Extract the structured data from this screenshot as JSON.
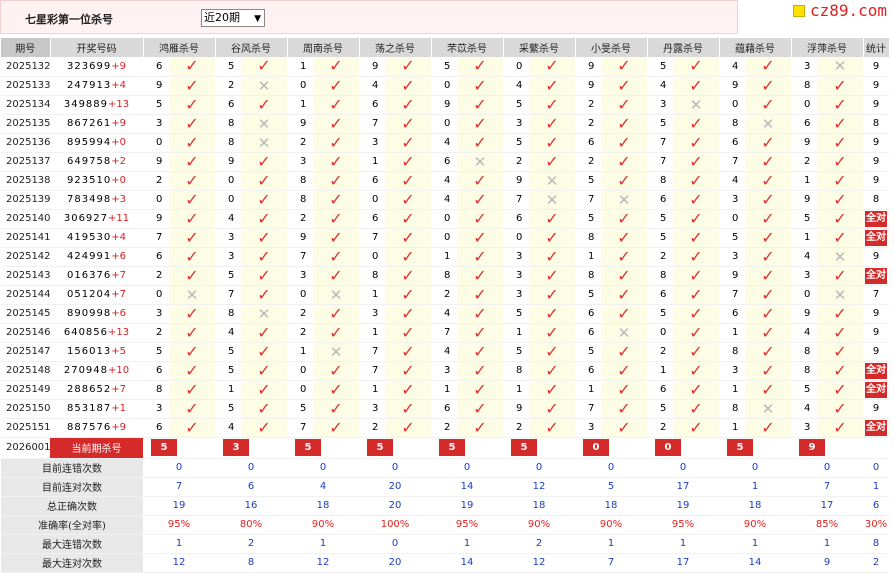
{
  "title": "七星彩第一位杀号",
  "period_select": {
    "value": "近20期"
  },
  "brand": {
    "text": "cz89.com"
  },
  "headers": [
    "期号",
    "开奖号码",
    "鸿雁杀号",
    "谷风杀号",
    "周南杀号",
    "荡之杀号",
    "芣苡杀号",
    "采蘩杀号",
    "小旻杀号",
    "丹露杀号",
    "蕴藉杀号",
    "浮萍杀号",
    "统计"
  ],
  "rows": [
    {
      "issue": "2025132",
      "draw": "323699",
      "plus": "+9",
      "kills": [
        [
          "6",
          1
        ],
        [
          "5",
          1
        ],
        [
          "1",
          1
        ],
        [
          "9",
          1
        ],
        [
          "5",
          1
        ],
        [
          "0",
          1
        ],
        [
          "9",
          1
        ],
        [
          "5",
          1
        ],
        [
          "4",
          1
        ],
        [
          "3",
          0
        ]
      ],
      "stat": "9"
    },
    {
      "issue": "2025133",
      "draw": "247913",
      "plus": "+4",
      "kills": [
        [
          "9",
          1
        ],
        [
          "2",
          0
        ],
        [
          "0",
          1
        ],
        [
          "4",
          1
        ],
        [
          "0",
          1
        ],
        [
          "4",
          1
        ],
        [
          "9",
          1
        ],
        [
          "4",
          1
        ],
        [
          "9",
          1
        ],
        [
          "8",
          1
        ]
      ],
      "stat": "9"
    },
    {
      "issue": "2025134",
      "draw": "349889",
      "plus": "+13",
      "kills": [
        [
          "5",
          1
        ],
        [
          "6",
          1
        ],
        [
          "1",
          1
        ],
        [
          "6",
          1
        ],
        [
          "9",
          1
        ],
        [
          "5",
          1
        ],
        [
          "2",
          1
        ],
        [
          "3",
          0
        ],
        [
          "0",
          1
        ],
        [
          "0",
          1
        ]
      ],
      "stat": "9"
    },
    {
      "issue": "2025135",
      "draw": "867261",
      "plus": "+9",
      "kills": [
        [
          "3",
          1
        ],
        [
          "8",
          0
        ],
        [
          "9",
          1
        ],
        [
          "7",
          1
        ],
        [
          "0",
          1
        ],
        [
          "3",
          1
        ],
        [
          "2",
          1
        ],
        [
          "5",
          1
        ],
        [
          "8",
          0
        ],
        [
          "6",
          1
        ]
      ],
      "stat": "8"
    },
    {
      "issue": "2025136",
      "draw": "895994",
      "plus": "+0",
      "kills": [
        [
          "0",
          1
        ],
        [
          "8",
          0
        ],
        [
          "2",
          1
        ],
        [
          "3",
          1
        ],
        [
          "4",
          1
        ],
        [
          "5",
          1
        ],
        [
          "6",
          1
        ],
        [
          "7",
          1
        ],
        [
          "6",
          1
        ],
        [
          "9",
          1
        ]
      ],
      "stat": "9"
    },
    {
      "issue": "2025137",
      "draw": "649758",
      "plus": "+2",
      "kills": [
        [
          "9",
          1
        ],
        [
          "9",
          1
        ],
        [
          "3",
          1
        ],
        [
          "1",
          1
        ],
        [
          "6",
          0
        ],
        [
          "2",
          1
        ],
        [
          "2",
          1
        ],
        [
          "7",
          1
        ],
        [
          "7",
          1
        ],
        [
          "2",
          1
        ]
      ],
      "stat": "9"
    },
    {
      "issue": "2025138",
      "draw": "923510",
      "plus": "+0",
      "kills": [
        [
          "2",
          1
        ],
        [
          "0",
          1
        ],
        [
          "8",
          1
        ],
        [
          "6",
          1
        ],
        [
          "4",
          1
        ],
        [
          "9",
          0
        ],
        [
          "5",
          1
        ],
        [
          "8",
          1
        ],
        [
          "4",
          1
        ],
        [
          "1",
          1
        ]
      ],
      "stat": "9"
    },
    {
      "issue": "2025139",
      "draw": "783498",
      "plus": "+3",
      "kills": [
        [
          "0",
          1
        ],
        [
          "0",
          1
        ],
        [
          "8",
          1
        ],
        [
          "0",
          1
        ],
        [
          "4",
          1
        ],
        [
          "7",
          0
        ],
        [
          "7",
          0
        ],
        [
          "6",
          1
        ],
        [
          "3",
          1
        ],
        [
          "9",
          1
        ]
      ],
      "stat": "8"
    },
    {
      "issue": "2025140",
      "draw": "306927",
      "plus": "+11",
      "kills": [
        [
          "9",
          1
        ],
        [
          "4",
          1
        ],
        [
          "2",
          1
        ],
        [
          "6",
          1
        ],
        [
          "0",
          1
        ],
        [
          "6",
          1
        ],
        [
          "5",
          1
        ],
        [
          "5",
          1
        ],
        [
          "0",
          1
        ],
        [
          "5",
          1
        ]
      ],
      "stat": "全对"
    },
    {
      "issue": "2025141",
      "draw": "419530",
      "plus": "+4",
      "kills": [
        [
          "7",
          1
        ],
        [
          "3",
          1
        ],
        [
          "9",
          1
        ],
        [
          "7",
          1
        ],
        [
          "0",
          1
        ],
        [
          "0",
          1
        ],
        [
          "8",
          1
        ],
        [
          "5",
          1
        ],
        [
          "5",
          1
        ],
        [
          "1",
          1
        ]
      ],
      "stat": "全对"
    },
    {
      "issue": "2025142",
      "draw": "424991",
      "plus": "+6",
      "kills": [
        [
          "6",
          1
        ],
        [
          "3",
          1
        ],
        [
          "7",
          1
        ],
        [
          "0",
          1
        ],
        [
          "1",
          1
        ],
        [
          "3",
          1
        ],
        [
          "1",
          1
        ],
        [
          "2",
          1
        ],
        [
          "3",
          1
        ],
        [
          "4",
          0
        ]
      ],
      "stat": "9"
    },
    {
      "issue": "2025143",
      "draw": "016376",
      "plus": "+7",
      "kills": [
        [
          "2",
          1
        ],
        [
          "5",
          1
        ],
        [
          "3",
          1
        ],
        [
          "8",
          1
        ],
        [
          "8",
          1
        ],
        [
          "3",
          1
        ],
        [
          "8",
          1
        ],
        [
          "8",
          1
        ],
        [
          "9",
          1
        ],
        [
          "3",
          1
        ]
      ],
      "stat": "全对"
    },
    {
      "issue": "2025144",
      "draw": "051204",
      "plus": "+7",
      "kills": [
        [
          "0",
          0
        ],
        [
          "7",
          1
        ],
        [
          "0",
          0
        ],
        [
          "1",
          1
        ],
        [
          "2",
          1
        ],
        [
          "3",
          1
        ],
        [
          "5",
          1
        ],
        [
          "6",
          1
        ],
        [
          "7",
          1
        ],
        [
          "0",
          0
        ]
      ],
      "stat": "7"
    },
    {
      "issue": "2025145",
      "draw": "890998",
      "plus": "+6",
      "kills": [
        [
          "3",
          1
        ],
        [
          "8",
          0
        ],
        [
          "2",
          1
        ],
        [
          "3",
          1
        ],
        [
          "4",
          1
        ],
        [
          "5",
          1
        ],
        [
          "6",
          1
        ],
        [
          "5",
          1
        ],
        [
          "6",
          1
        ],
        [
          "9",
          1
        ]
      ],
      "stat": "9"
    },
    {
      "issue": "2025146",
      "draw": "640856",
      "plus": "+13",
      "kills": [
        [
          "2",
          1
        ],
        [
          "4",
          1
        ],
        [
          "2",
          1
        ],
        [
          "1",
          1
        ],
        [
          "7",
          1
        ],
        [
          "1",
          1
        ],
        [
          "6",
          0
        ],
        [
          "0",
          1
        ],
        [
          "1",
          1
        ],
        [
          "4",
          1
        ]
      ],
      "stat": "9"
    },
    {
      "issue": "2025147",
      "draw": "156013",
      "plus": "+5",
      "kills": [
        [
          "5",
          1
        ],
        [
          "5",
          1
        ],
        [
          "1",
          0
        ],
        [
          "7",
          1
        ],
        [
          "4",
          1
        ],
        [
          "5",
          1
        ],
        [
          "5",
          1
        ],
        [
          "2",
          1
        ],
        [
          "8",
          1
        ],
        [
          "8",
          1
        ]
      ],
      "stat": "9"
    },
    {
      "issue": "2025148",
      "draw": "270948",
      "plus": "+10",
      "kills": [
        [
          "6",
          1
        ],
        [
          "5",
          1
        ],
        [
          "0",
          1
        ],
        [
          "7",
          1
        ],
        [
          "3",
          1
        ],
        [
          "8",
          1
        ],
        [
          "6",
          1
        ],
        [
          "1",
          1
        ],
        [
          "3",
          1
        ],
        [
          "8",
          1
        ]
      ],
      "stat": "全对"
    },
    {
      "issue": "2025149",
      "draw": "288652",
      "plus": "+7",
      "kills": [
        [
          "8",
          1
        ],
        [
          "1",
          1
        ],
        [
          "0",
          1
        ],
        [
          "1",
          1
        ],
        [
          "1",
          1
        ],
        [
          "1",
          1
        ],
        [
          "1",
          1
        ],
        [
          "6",
          1
        ],
        [
          "1",
          1
        ],
        [
          "5",
          1
        ]
      ],
      "stat": "全对"
    },
    {
      "issue": "2025150",
      "draw": "853187",
      "plus": "+1",
      "kills": [
        [
          "3",
          1
        ],
        [
          "5",
          1
        ],
        [
          "5",
          1
        ],
        [
          "3",
          1
        ],
        [
          "6",
          1
        ],
        [
          "9",
          1
        ],
        [
          "7",
          1
        ],
        [
          "5",
          1
        ],
        [
          "8",
          0
        ],
        [
          "4",
          1
        ]
      ],
      "stat": "9"
    },
    {
      "issue": "2025151",
      "draw": "887576",
      "plus": "+9",
      "kills": [
        [
          "6",
          1
        ],
        [
          "4",
          1
        ],
        [
          "7",
          1
        ],
        [
          "2",
          1
        ],
        [
          "2",
          1
        ],
        [
          "2",
          1
        ],
        [
          "3",
          1
        ],
        [
          "2",
          1
        ],
        [
          "1",
          1
        ],
        [
          "3",
          1
        ]
      ],
      "stat": "全对"
    }
  ],
  "current": {
    "issue": "2026001",
    "label": "当前期杀号",
    "values": [
      "5",
      "3",
      "5",
      "5",
      "5",
      "5",
      "0",
      "0",
      "5",
      "9"
    ]
  },
  "stats": [
    {
      "label": "目前连错次数",
      "values": [
        "0",
        "0",
        "0",
        "0",
        "0",
        "0",
        "0",
        "0",
        "0",
        "0"
      ],
      "total": "0",
      "red": false
    },
    {
      "label": "目前连对次数",
      "values": [
        "7",
        "6",
        "4",
        "20",
        "14",
        "12",
        "5",
        "17",
        "1",
        "7"
      ],
      "total": "1",
      "red": false
    },
    {
      "label": "总正确次数",
      "values": [
        "19",
        "16",
        "18",
        "20",
        "19",
        "18",
        "18",
        "19",
        "18",
        "17"
      ],
      "total": "6",
      "red": false
    },
    {
      "label": "准确率(全对率)",
      "values": [
        "95%",
        "80%",
        "90%",
        "100%",
        "95%",
        "90%",
        "90%",
        "95%",
        "90%",
        "85%"
      ],
      "total": "30%",
      "red": true
    },
    {
      "label": "最大连错次数",
      "values": [
        "1",
        "2",
        "1",
        "0",
        "1",
        "2",
        "1",
        "1",
        "1",
        "1"
      ],
      "total": "8",
      "red": false
    },
    {
      "label": "最大连对次数",
      "values": [
        "12",
        "8",
        "12",
        "20",
        "14",
        "12",
        "7",
        "17",
        "14",
        "9"
      ],
      "total": "2",
      "red": false
    }
  ]
}
